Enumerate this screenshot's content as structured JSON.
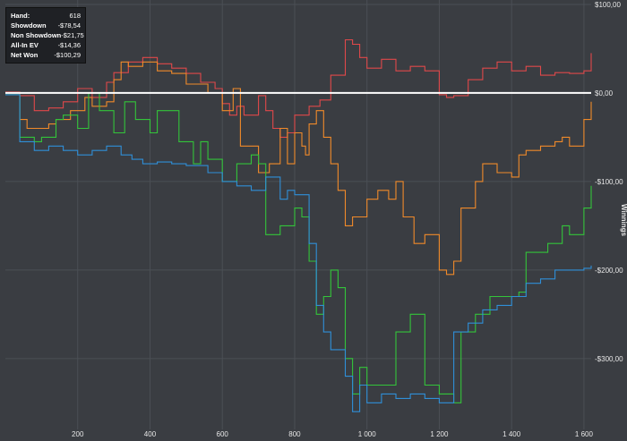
{
  "colors": {
    "background": "#3a3d42",
    "grid": "#4b4f55",
    "zero_line": "#ffffff",
    "net_won": "#2f8fd8",
    "all_in_ev": "#33c43a",
    "showdown": "#f08a2a",
    "non_showdown": "#e0484a"
  },
  "stats": {
    "rows": [
      {
        "label": "Hand:",
        "value": "618"
      },
      {
        "label": "Showdown",
        "value": "-$78,54"
      },
      {
        "label": "Non Showdown",
        "value": "-$21,75"
      },
      {
        "label": "All-In EV",
        "value": "-$14,36"
      },
      {
        "label": "Net Won",
        "value": "-$100,29"
      }
    ]
  },
  "chart_data": {
    "type": "line",
    "ylabel": "Winnings",
    "xlabel": "",
    "xlim": [
      0,
      1620
    ],
    "ylim": [
      -380,
      105
    ],
    "x_ticks": [
      {
        "value": 200,
        "label": "200"
      },
      {
        "value": 400,
        "label": "400"
      },
      {
        "value": 600,
        "label": "600"
      },
      {
        "value": 800,
        "label": "800"
      },
      {
        "value": 1000,
        "label": "1 000"
      },
      {
        "value": 1200,
        "label": "1 200"
      },
      {
        "value": 1400,
        "label": "1 400"
      },
      {
        "value": 1600,
        "label": "1 600"
      }
    ],
    "y_ticks": [
      {
        "value": 100,
        "label": "$100,00"
      },
      {
        "value": 0,
        "label": "$0,00"
      },
      {
        "value": -100,
        "label": "-$100,00"
      },
      {
        "value": -200,
        "label": "-$200,00"
      },
      {
        "value": -300,
        "label": "-$300,00"
      }
    ],
    "grid": true,
    "series": [
      {
        "key": "non_showdown",
        "x": [
          0,
          40,
          80,
          120,
          160,
          200,
          240,
          280,
          300,
          340,
          380,
          420,
          460,
          500,
          540,
          580,
          600,
          620,
          640,
          660,
          700,
          720,
          740,
          760,
          780,
          800,
          840,
          870,
          900,
          940,
          960,
          980,
          1000,
          1040,
          1080,
          1120,
          1160,
          1200,
          1220,
          1240,
          1280,
          1320,
          1360,
          1400,
          1440,
          1480,
          1520,
          1560,
          1600,
          1620
        ],
        "y": [
          1,
          -3,
          -20,
          -17,
          -10,
          5,
          -5,
          12,
          23,
          35,
          40,
          33,
          28,
          22,
          12,
          5,
          -12,
          -25,
          -15,
          -25,
          -3,
          -20,
          -40,
          -50,
          -45,
          -25,
          -15,
          -8,
          20,
          60,
          55,
          40,
          28,
          38,
          25,
          30,
          25,
          -2,
          -5,
          -3,
          15,
          28,
          35,
          25,
          30,
          20,
          23,
          22,
          25,
          45
        ]
      },
      {
        "key": "showdown",
        "x": [
          0,
          40,
          60,
          120,
          140,
          180,
          220,
          240,
          280,
          300,
          320,
          340,
          380,
          420,
          460,
          500,
          560,
          600,
          630,
          650,
          700,
          730,
          760,
          780,
          800,
          820,
          830,
          840,
          860,
          880,
          900,
          920,
          940,
          960,
          1000,
          1030,
          1060,
          1080,
          1100,
          1130,
          1160,
          1200,
          1220,
          1240,
          1260,
          1300,
          1320,
          1360,
          1400,
          1420,
          1440,
          1480,
          1520,
          1540,
          1560,
          1600,
          1620
        ],
        "y": [
          -2,
          -30,
          -40,
          -35,
          -30,
          -20,
          -5,
          -15,
          -10,
          15,
          35,
          30,
          35,
          25,
          22,
          10,
          0,
          -20,
          5,
          -60,
          -90,
          -80,
          -40,
          -80,
          -45,
          -60,
          -70,
          -35,
          -20,
          -50,
          -80,
          -110,
          -150,
          -140,
          -120,
          -110,
          -120,
          -100,
          -140,
          -170,
          -160,
          -200,
          -205,
          -190,
          -130,
          -100,
          -80,
          -90,
          -95,
          -70,
          -65,
          -60,
          -55,
          -50,
          -60,
          -30,
          -10
        ]
      },
      {
        "key": "all_in_ev",
        "x": [
          0,
          40,
          80,
          100,
          140,
          160,
          200,
          230,
          260,
          300,
          330,
          360,
          400,
          420,
          480,
          520,
          540,
          560,
          600,
          640,
          680,
          700,
          720,
          760,
          800,
          820,
          840,
          860,
          880,
          900,
          920,
          940,
          960,
          980,
          1000,
          1040,
          1080,
          1120,
          1160,
          1200,
          1240,
          1260,
          1300,
          1340,
          1380,
          1420,
          1440,
          1500,
          1540,
          1560,
          1600,
          1620
        ],
        "y": [
          -2,
          -50,
          -55,
          -50,
          -30,
          -25,
          -40,
          0,
          -20,
          -45,
          -10,
          -30,
          -45,
          -20,
          -55,
          -80,
          -55,
          -75,
          -100,
          -80,
          -70,
          -80,
          -160,
          -150,
          -130,
          -140,
          -190,
          -250,
          -230,
          -200,
          -220,
          -300,
          -340,
          -310,
          -330,
          -330,
          -270,
          -250,
          -330,
          -340,
          -350,
          -270,
          -250,
          -230,
          -230,
          -225,
          -180,
          -170,
          -150,
          -160,
          -130,
          -105
        ]
      },
      {
        "key": "net_won",
        "x": [
          0,
          40,
          80,
          120,
          160,
          200,
          240,
          280,
          320,
          350,
          380,
          420,
          460,
          500,
          560,
          600,
          640,
          680,
          720,
          760,
          780,
          800,
          840,
          860,
          880,
          900,
          940,
          960,
          980,
          1000,
          1040,
          1080,
          1120,
          1160,
          1200,
          1240,
          1280,
          1320,
          1360,
          1400,
          1440,
          1480,
          1520,
          1560,
          1600,
          1620
        ],
        "y": [
          -2,
          -55,
          -65,
          -60,
          -65,
          -70,
          -65,
          -60,
          -70,
          -75,
          -80,
          -78,
          -80,
          -82,
          -90,
          -100,
          -105,
          -110,
          -95,
          -120,
          -110,
          -115,
          -170,
          -240,
          -270,
          -290,
          -320,
          -360,
          -330,
          -350,
          -340,
          -345,
          -340,
          -345,
          -350,
          -270,
          -260,
          -245,
          -240,
          -230,
          -215,
          -210,
          -200,
          -200,
          -198,
          -195
        ]
      }
    ]
  }
}
